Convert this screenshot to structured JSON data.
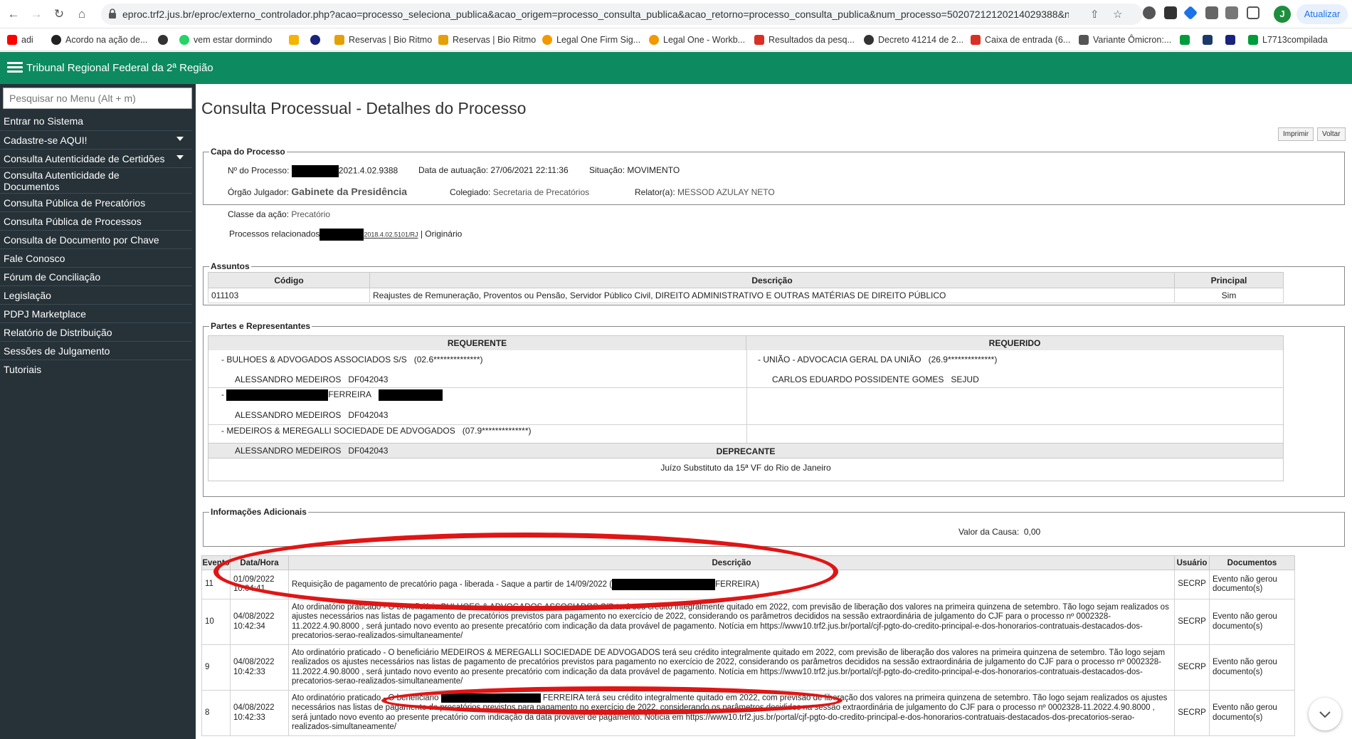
{
  "browser": {
    "url": "eproc.trf2.jus.br/eproc/externo_controlador.php?acao=processo_seleciona_publica&acao_origem=processo_consulta_publica&acao_retorno=processo_consulta_publica&num_processo=50207212120214029388&num...",
    "profile_initial": "J",
    "update_label": "Atualizar",
    "bookmarks": [
      {
        "label": "adi",
        "icon": "youtube-icon",
        "color": "#ff0000"
      },
      {
        "label": "Acordo na ação de...",
        "icon": "site-icon",
        "color": "#222222"
      },
      {
        "label": "",
        "icon": "github-icon",
        "color": "#333333"
      },
      {
        "label": "vem estar dormindo",
        "icon": "whatsapp-icon",
        "color": "#25d366"
      },
      {
        "label": "",
        "icon": "drive-icon",
        "color": "#f4b400"
      },
      {
        "label": "",
        "icon": "site-icon",
        "color": "#1a237e"
      },
      {
        "label": "Reservas | Bio Ritmo",
        "icon": "site-icon",
        "color": "#e3a008"
      },
      {
        "label": "Reservas | Bio Ritmo",
        "icon": "site-icon",
        "color": "#e3a008"
      },
      {
        "label": "Legal One Firm Sig...",
        "icon": "site-icon",
        "color": "#f29900"
      },
      {
        "label": "Legal One - Workb...",
        "icon": "site-icon",
        "color": "#f29900"
      },
      {
        "label": "Resultados da pesq...",
        "icon": "gmail-icon",
        "color": "#d93025"
      },
      {
        "label": "Decreto 41214 de 2...",
        "icon": "github-icon",
        "color": "#333333"
      },
      {
        "label": "Caixa de entrada (6...",
        "icon": "gmail-icon",
        "color": "#d93025"
      },
      {
        "label": "Variante Ômicron:...",
        "icon": "site-icon",
        "color": "#555555"
      },
      {
        "label": "",
        "icon": "flag-icon",
        "color": "#009c3b"
      },
      {
        "label": "",
        "icon": "pje-icon",
        "color": "#1b3a6b"
      },
      {
        "label": "",
        "icon": "site-icon",
        "color": "#1a237e"
      },
      {
        "label": "L7713compilada",
        "icon": "flag-icon",
        "color": "#009c3b"
      }
    ]
  },
  "header": {
    "title": "Tribunal Regional Federal da 2ª Região"
  },
  "sidebar": {
    "search_placeholder": "Pesquisar no Menu (Alt + m)",
    "items": [
      {
        "label": "Entrar no Sistema"
      },
      {
        "label": "Cadastre-se AQUI!"
      },
      {
        "label": "Consulta Autenticidade de Certidões"
      },
      {
        "label": "Consulta Autenticidade de Documentos"
      },
      {
        "label": "Consulta Pública de Precatórios"
      },
      {
        "label": "Consulta Pública de Processos"
      },
      {
        "label": "Consulta de Documento por Chave"
      },
      {
        "label": "Fale Conosco"
      },
      {
        "label": "Fórum de Conciliação"
      },
      {
        "label": "Legislação"
      },
      {
        "label": "PDPJ Marketplace"
      },
      {
        "label": "Relatório de Distribuição"
      },
      {
        "label": "Sessões de Julgamento"
      },
      {
        "label": "Tutoriais"
      }
    ]
  },
  "page": {
    "title": "Consulta Processual - Detalhes do Processo",
    "print_label": "Imprimir",
    "back_label": "Voltar"
  },
  "capa": {
    "legend": "Capa do Processo",
    "num_label": "Nº do Processo:",
    "num_value": "2021.4.02.9388",
    "data_label": "Data de autuação:",
    "data_value": "27/06/2021 22:11:36",
    "situacao_label": "Situação:",
    "situacao_value": "MOVIMENTO",
    "orgao_label": "Órgão Julgador:",
    "orgao_value": "Gabinete da Presidência",
    "colegiado_label": "Colegiado:",
    "colegiado_value": "Secretaria de Precatórios",
    "relator_label": "Relator(a):",
    "relator_value": "MESSOD AZULAY NETO",
    "classe_label": "Classe da ação:",
    "classe_value": "Precatório",
    "relacionados_label": "Processos relacionados",
    "relacionados_link": "2018.4.02.5101/RJ",
    "relacionados_tipo": "| Originário"
  },
  "assuntos": {
    "legend": "Assuntos",
    "headers": [
      "Código",
      "Descrição",
      "Principal"
    ],
    "rows": [
      {
        "codigo": "011103",
        "descricao": "Reajustes de Remuneração, Proventos ou Pensão, Servidor Público Civil, DIREITO ADMINISTRATIVO E OUTRAS MATÉRIAS DE DIREITO PÚBLICO",
        "principal": "Sim"
      }
    ]
  },
  "partes": {
    "legend": "Partes e Representantes",
    "requerente_header": "REQUERENTE",
    "requerido_header": "REQUERIDO",
    "deprecante_header": "DEPRECANTE",
    "deprecante_value": "Juízo Substituto da 15ª VF do Rio de Janeiro",
    "requerente": [
      {
        "nome": "- BULHOES & ADVOGADOS ASSOCIADOS S/S",
        "doc": "(02.6**************)",
        "advogado": "ALESSANDRO MEDEIROS",
        "oab": "DF042043"
      },
      {
        "nome": "FERREIRA",
        "doc": "",
        "advogado": "ALESSANDRO MEDEIROS",
        "oab": "DF042043"
      },
      {
        "nome": "- MEDEIROS & MEREGALLI SOCIEDADE DE ADVOGADOS",
        "doc": "(07.9**************)",
        "advogado": "ALESSANDRO MEDEIROS",
        "oab": "DF042043"
      }
    ],
    "requerido": [
      {
        "nome": "- UNIÃO - ADVOCACIA GERAL DA UNIÃO",
        "doc": "(26.9**************)",
        "advogado": "CARLOS EDUARDO POSSIDENTE GOMES",
        "oab": "SEJUD"
      }
    ]
  },
  "info": {
    "legend": "Informações Adicionais",
    "valor_label": "Valor da Causa:",
    "valor_value": "0,00"
  },
  "eventos": {
    "headers": [
      "Evento",
      "Data/Hora",
      "Descrição",
      "Usuário",
      "Documentos"
    ],
    "rows": [
      {
        "evento": "11",
        "data": "01/09/2022",
        "hora": "10:04:41",
        "desc_a": "Requisição de pagamento de precatório paga - liberada - Saque a partir de 14/09/2022 (",
        "desc_b": "FERREIRA)",
        "usuario": "SECRP",
        "documentos": "Evento não gerou documento(s)"
      },
      {
        "evento": "10",
        "data": "04/08/2022",
        "hora": "10:42:34",
        "desc": "Ato ordinatório praticado - O beneficiário BULHOES & ADVOGADOS ASSOCIADOS S/S terá seu crédito integralmente quitado em 2022, com previsão de liberação dos valores na primeira quinzena de setembro. Tão logo sejam realizados os ajustes necessários nas listas de pagamento de precatórios previstos para pagamento no exercício de 2022, considerando os parâmetros decididos na sessão extraordinária de julgamento do CJF para o processo nº 0002328-11.2022.4.90.8000 , será juntado novo evento ao presente precatório com indicação da data provável de pagamento. Notícia em https://www10.trf2.jus.br/portal/cjf-pgto-do-credito-principal-e-dos-honorarios-contratuais-destacados-dos-precatorios-serao-realizados-simultaneamente/",
        "usuario": "SECRP",
        "documentos": "Evento não gerou documento(s)"
      },
      {
        "evento": "9",
        "data": "04/08/2022",
        "hora": "10:42:33",
        "desc": "Ato ordinatório praticado - O beneficiário MEDEIROS & MEREGALLI SOCIEDADE DE ADVOGADOS terá seu crédito integralmente quitado em 2022, com previsão de liberação dos valores na primeira quinzena de setembro. Tão logo sejam realizados os ajustes necessários nas listas de pagamento de precatórios previstos para pagamento no exercício de 2022, considerando os parâmetros decididos na sessão extraordinária de julgamento do CJF para o processo nº 0002328-11.2022.4.90.8000 , será juntado novo evento ao presente precatório com indicação da data provável de pagamento. Notícia em https://www10.trf2.jus.br/portal/cjf-pgto-do-credito-principal-e-dos-honorarios-contratuais-destacados-dos-precatorios-serao-realizados-simultaneamente/",
        "usuario": "SECRP",
        "documentos": "Evento não gerou documento(s)"
      },
      {
        "evento": "8",
        "data": "04/08/2022",
        "hora": "10:42:33",
        "desc_a": "Ato ordinatório praticado - O beneficiário",
        "desc_b": "FERREIRA terá seu crédito integralmente quitado em 2022, com previsão de liberação dos valores na primeira quinzena de setembro. Tão logo sejam realizados os ajustes necessários nas listas de pagamento de precatórios previstos para pagamento no exercício de 2022, considerando os parâmetros decididos na sessão extraordinária de julgamento do CJF para o processo nº 0002328-11.2022.4.90.8000 , será juntado novo evento ao presente precatório com indicação da data provável de pagamento. Notícia em https://www10.trf2.jus.br/portal/cjf-pgto-do-credito-principal-e-dos-honorarios-contratuais-destacados-dos-precatorios-serao-realizados-simultaneamente/",
        "usuario": "SECRP",
        "documentos": "Evento não gerou documento(s)"
      }
    ]
  },
  "colors": {
    "header_green": "#0e8a60",
    "sidebar_bg": "#263238",
    "annotation_red": "#e01515"
  }
}
